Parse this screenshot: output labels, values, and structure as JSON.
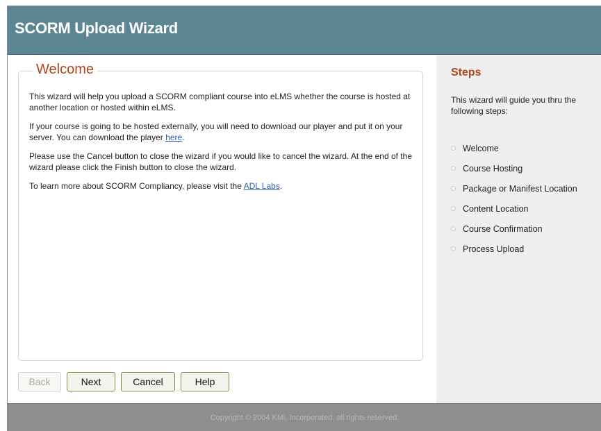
{
  "header": {
    "title": "SCORM Upload Wizard"
  },
  "welcome": {
    "legend": "Welcome",
    "paragraph1": "This wizard will help you upload a SCORM compliant course into eLMS whether the course is hosted at another location or hosted within eLMS.",
    "paragraph2_text": "If your course is going to be hosted externally, you will need to download our player and put it on your server. You can download the player ",
    "paragraph2_link": "here",
    "paragraph2_end": ".",
    "paragraph3": "Please use the Cancel button to close the wizard if you would like to cancel the wizard. At the end of the wizard please click the Finish button to close the wizard.",
    "paragraph4_text": "To learn more about SCORM Compliancy, please visit the ",
    "paragraph4_link": "ADL Labs",
    "paragraph4_end": "."
  },
  "buttons": {
    "back": "Back",
    "next": "Next",
    "cancel": "Cancel",
    "help": "Help"
  },
  "steps": {
    "title": "Steps",
    "intro": "This wizard will guide you thru the following steps:",
    "items": [
      "Welcome",
      "Course Hosting",
      "Package or Manifest Location",
      "Content Location",
      "Course Confirmation",
      "Process Upload"
    ]
  },
  "footer": {
    "copyright": "Copyright © 2004 KMi, Incorporated, all rights reserved."
  },
  "colors": {
    "header_bg": "#5d8694",
    "accent": "#b0461c",
    "link": "#2f5fb0",
    "steps_bg": "#efefef",
    "footer_bg": "#8e8e8e"
  }
}
